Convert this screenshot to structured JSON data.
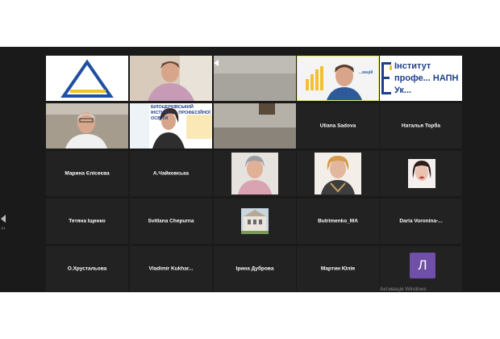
{
  "pager": {
    "page": "1/1"
  },
  "colors": {
    "speaker_highlight": "#e9ea70",
    "avatar_bg": "#6f4fa8",
    "tile_bg": "#222222"
  },
  "participants": [
    {
      "name": "Uliana Sadova"
    },
    {
      "name": "Наталья Торба"
    },
    {
      "name": "Марина Єлісеєва"
    },
    {
      "name": "А.Чайковська"
    },
    {
      "name": "Тетяна Іщенко"
    },
    {
      "name": "Svitlana Chepurna"
    },
    {
      "name": "Butrimenko_MA"
    },
    {
      "name": "Daria  Voronina-..."
    },
    {
      "name": "О.Хрустальова"
    },
    {
      "name": "Vladimir  Kukhar..."
    },
    {
      "name": "Ірина Дуброва"
    },
    {
      "name": "Мартин Юлія"
    }
  ],
  "video_texts": {
    "institute_banner": "Інститут профе... НАПН Ук...",
    "banner_bila": "БІЛОЦЕРКІВСЬКИЙ ІНСТИТУТ ... ПРОФЕСІЙНОЇ ОСВІТИ",
    "banner_short": "...вацій"
  },
  "avatar_letter": "Л",
  "watermark": "Активація Windows"
}
